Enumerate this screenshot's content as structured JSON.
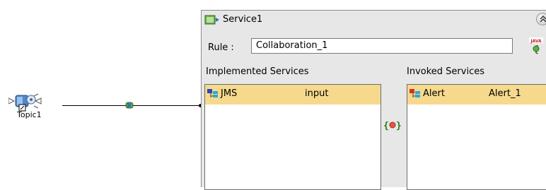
{
  "topic": {
    "label": "Topic1"
  },
  "service": {
    "title": "Service1",
    "rule_label": "Rule :",
    "rule_value": "Collaboration_1",
    "implemented_label": "Implemented Services",
    "invoked_label": "Invoked Services",
    "implemented": [
      {
        "name": "JMS",
        "value": "input"
      }
    ],
    "invoked": [
      {
        "name": "Alert",
        "value": "Alert_1"
      }
    ]
  },
  "colors": {
    "panel_bg": "#e7e7e7",
    "row_highlight": "#f6d98d",
    "topic_blue": "#4f86c8"
  },
  "icons": {
    "topic": "topic-node-icon",
    "connector": "connector-icon",
    "service": "service-icon",
    "collapse": "collapse-up-icon",
    "java": "java-collaboration-icon",
    "mapping": "mapping-icon",
    "jms": "jms-service-icon",
    "alert": "alert-service-icon"
  }
}
